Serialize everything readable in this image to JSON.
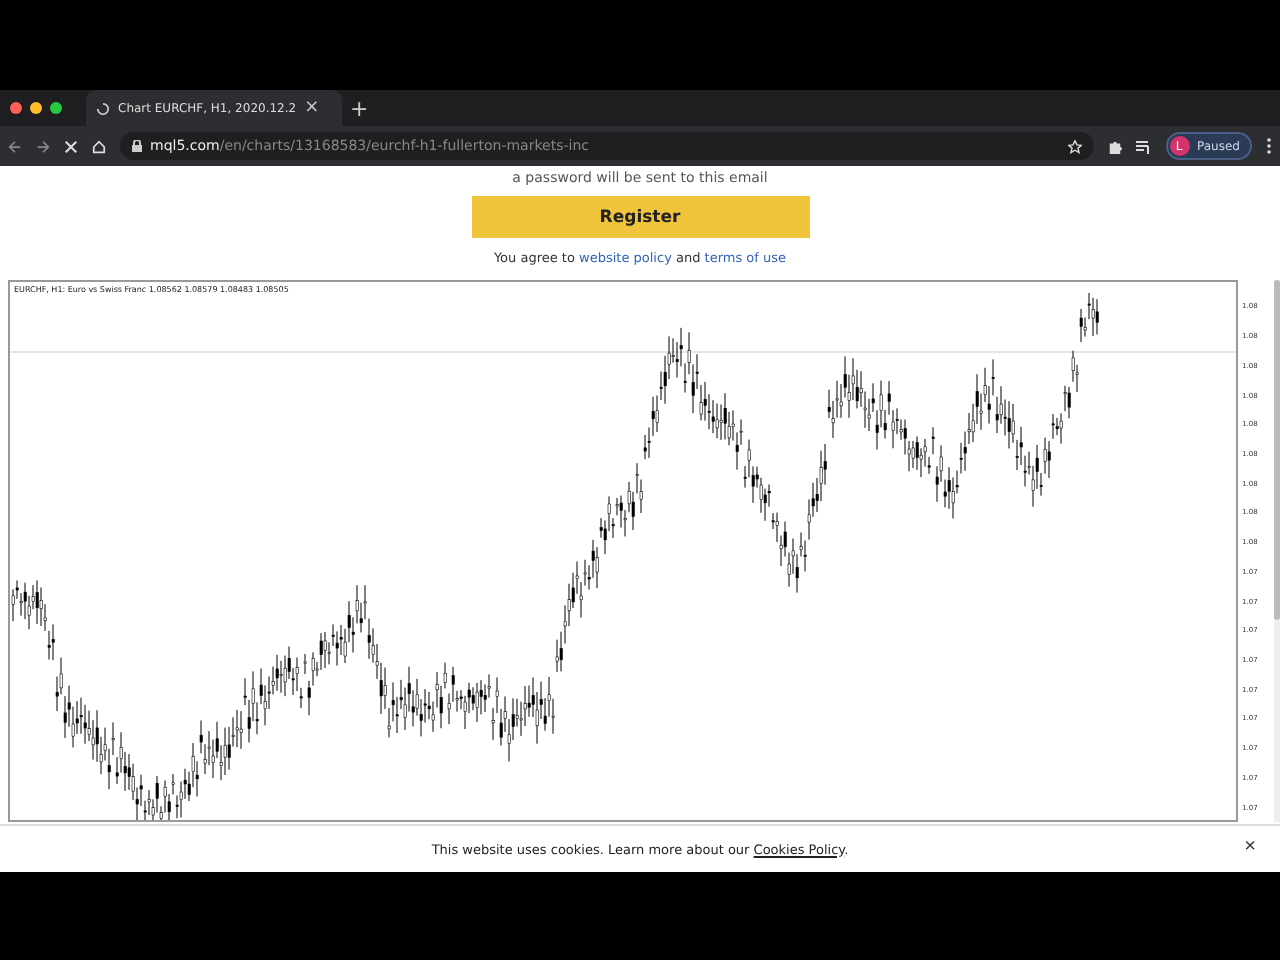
{
  "browser": {
    "tab": {
      "title": "Chart EURCHF, H1, 2020.12.2",
      "close": "×",
      "loading": true
    },
    "new_tab": "+",
    "url": {
      "domain": "mql5.com",
      "path": "/en/charts/13168583/eurchf-h1-fullerton-markets-inc"
    },
    "profile": {
      "initial": "L",
      "status": "Paused"
    }
  },
  "signup": {
    "hint": "a password will be sent to this email",
    "button": "Register",
    "agreement": [
      {
        "kind": "text",
        "text": "You agree to "
      },
      {
        "kind": "link",
        "text": "website policy"
      },
      {
        "kind": "text",
        "text": " and "
      },
      {
        "kind": "link",
        "text": "terms of use"
      }
    ]
  },
  "chart": {
    "header": "EURCHF, H1:  Euro vs Swiss Franc  1.08562 1.08579 1.08483 1.08505",
    "price_labels": [
      "1.08",
      "1.08",
      "1.08",
      "1.08",
      "1.08",
      "1.08",
      "1.08",
      "1.08",
      "1.08",
      "1.07",
      "1.07",
      "1.07",
      "1.07",
      "1.07",
      "1.07",
      "1.07",
      "1.07",
      "1.07"
    ]
  },
  "cookie_banner": {
    "text": "This website uses cookies. Learn more about our ",
    "link": "Cookies Policy",
    "end": ".",
    "close": "×"
  }
}
